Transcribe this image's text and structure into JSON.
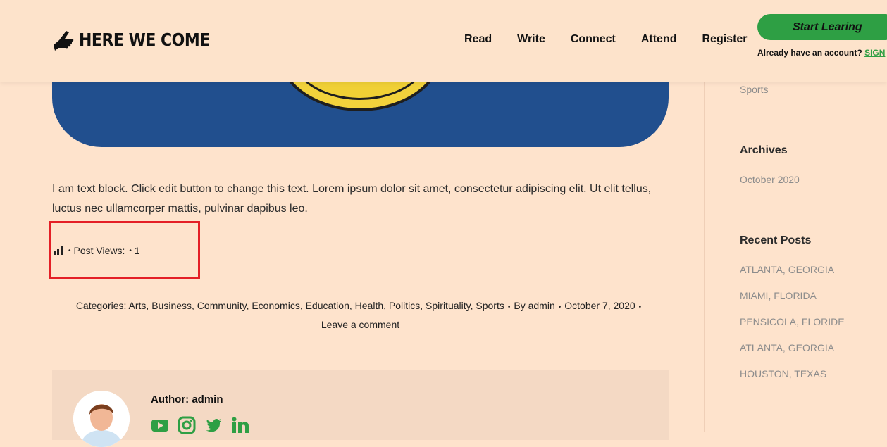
{
  "header": {
    "logo_text": "HERE WE COME",
    "nav": [
      "Read",
      "Write",
      "Connect",
      "Attend",
      "Register"
    ],
    "cta_label": "Start Learing",
    "account_text": "Already have an account?",
    "sign_link": "SIGN"
  },
  "article": {
    "body": "I am text block. Click edit button to change this text. Lorem ipsum dolor sit amet, consectetur adipiscing elit. Ut elit tellus, luctus nec ullamcorper mattis, pulvinar dapibus leo.",
    "views_label": "Post Views:",
    "views_count": "1",
    "categories_label": "Categories:",
    "categories": [
      "Arts",
      "Business",
      "Community",
      "Economics",
      "Education",
      "Health",
      "Politics",
      "Spirituality",
      "Sports"
    ],
    "by_label": "By",
    "author": "admin",
    "date": "October 7, 2020",
    "comment_link": "Leave a comment"
  },
  "author_box": {
    "label": "Author: admin",
    "socials": [
      "youtube-icon",
      "instagram-icon",
      "twitter-icon",
      "linkedin-icon"
    ],
    "social_color": "#2e9f44"
  },
  "sidebar": {
    "top_link": "Sports",
    "archives_title": "Archives",
    "archives": [
      "October 2020"
    ],
    "recent_title": "Recent Posts",
    "recent": [
      "ATLANTA, GEORGIA",
      "MIAMI, FLORIDA",
      "PENSICOLA, FLORIDE",
      "ATLANTA, GEORGIA",
      "HOUSTON, TEXAS"
    ]
  },
  "colors": {
    "background": "#fee3cc",
    "accent": "#2e9f44",
    "highlight_box": "#e41f26"
  }
}
